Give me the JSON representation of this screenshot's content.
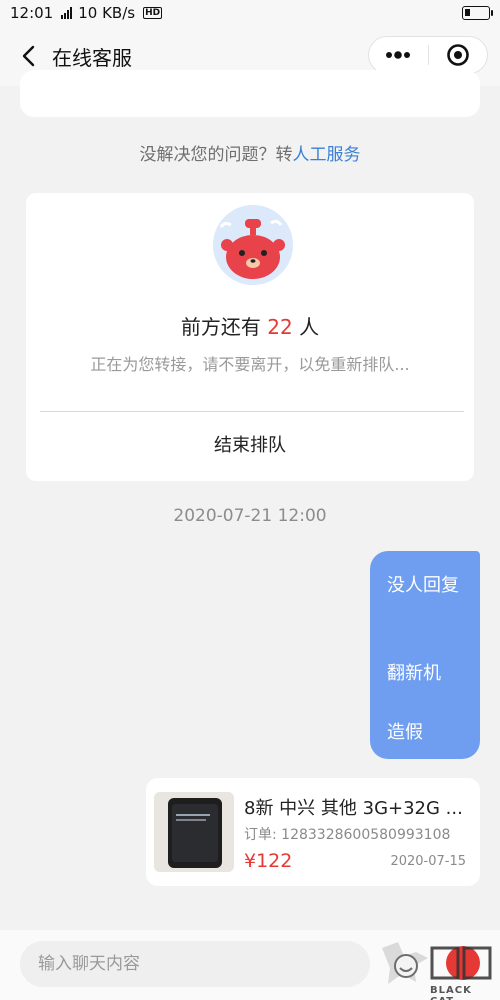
{
  "status_bar": {
    "time": "12:01",
    "net_type": "4G",
    "speed": "10 KB/s",
    "hd": "HD"
  },
  "header": {
    "title": "在线客服"
  },
  "hint": {
    "prefix": "没解决您的问题？转",
    "link": "人工服务"
  },
  "queue": {
    "count_prefix": "前方还有 ",
    "count": "22",
    "count_suffix": " 人",
    "note": "正在为您转接，请不要离开，以免重新排队...",
    "end_label": "结束排队"
  },
  "chat": {
    "timestamp": "2020-07-21 12:00",
    "outgoing_lines": [
      "没人回复",
      "翻新机",
      "造假"
    ],
    "product": {
      "title": "8新 中兴 其他 3G+32G ...",
      "order": "订单: 1283328600580993108",
      "price": "¥122",
      "date": "2020-07-15"
    }
  },
  "input": {
    "placeholder": "输入聊天内容"
  },
  "watermark": {
    "text": "BLACK CAT"
  },
  "colors": {
    "accent_blue": "#3b7fd6",
    "bubble_blue": "#6f9ef0",
    "price_red": "#e53935"
  }
}
